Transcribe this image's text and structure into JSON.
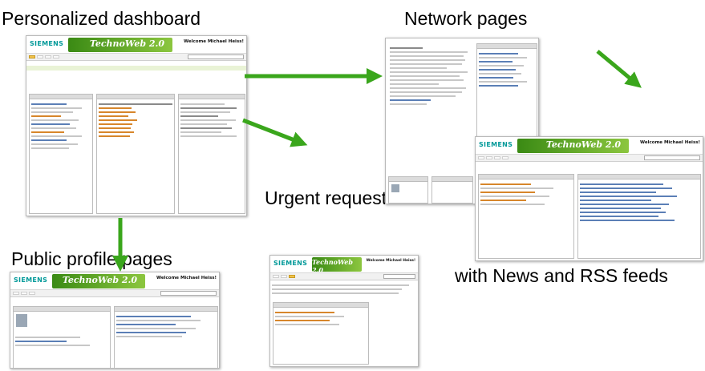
{
  "captions": {
    "dashboard": "Personalized dashboard",
    "network": "Network pages",
    "urgent": "Urgent requests",
    "profile": "Public profile pages",
    "news": "with News and RSS feeds"
  },
  "app": {
    "brand": "SIEMENS",
    "product": "TechnoWeb 2.0",
    "welcome": "Welcome Michael Heiss!"
  },
  "colors": {
    "arrow": "#3aa61c",
    "brand_green": "#8cc63f",
    "active_tab": "#f2c24a"
  }
}
